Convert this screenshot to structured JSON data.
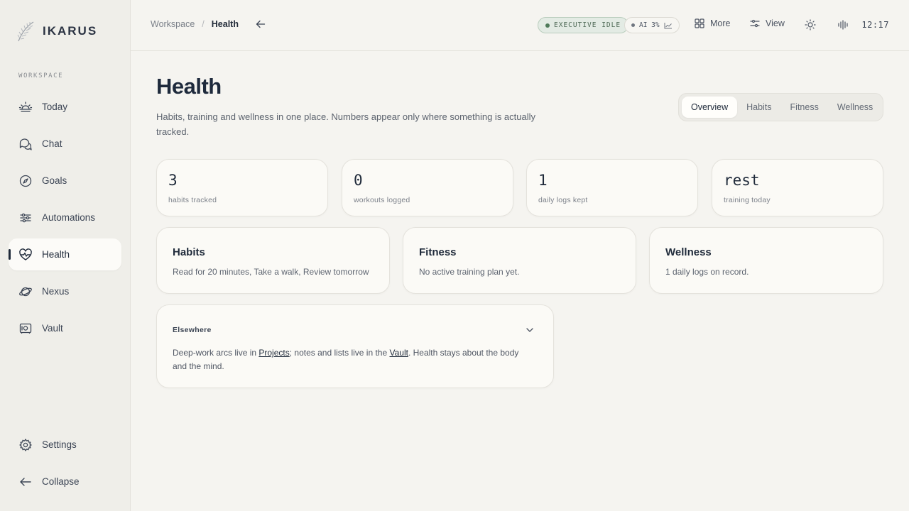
{
  "brand": {
    "name": "IKARUS"
  },
  "sidebar": {
    "section_label": "WORKSPACE",
    "items": [
      {
        "label": "Today",
        "icon": "sunrise-icon"
      },
      {
        "label": "Chat",
        "icon": "chat-bubbles-icon"
      },
      {
        "label": "Goals",
        "icon": "compass-icon"
      },
      {
        "label": "Automations",
        "icon": "sliders-icon"
      },
      {
        "label": "Health",
        "icon": "heart-pulse-icon",
        "active": true
      },
      {
        "label": "Nexus",
        "icon": "planet-icon"
      },
      {
        "label": "Vault",
        "icon": "safe-icon"
      }
    ],
    "settings_label": "Settings",
    "collapse_label": "Collapse"
  },
  "topbar": {
    "breadcrumb": {
      "root": "Workspace",
      "separator": "/",
      "current": "Health"
    },
    "status_badge": "EXECUTIVE IDLE",
    "ai_badge": "AI 3%",
    "more_label": "More",
    "view_label": "View",
    "clock": "12:17"
  },
  "main": {
    "title": "Health",
    "subtitle": "Habits, training and wellness in one place. Numbers appear only where something is actually tracked.",
    "tabs": [
      "Overview",
      "Habits",
      "Fitness",
      "Wellness"
    ],
    "active_tab": "Overview",
    "stats": [
      {
        "value": "3",
        "label": "habits tracked"
      },
      {
        "value": "0",
        "label": "workouts logged"
      },
      {
        "value": "1",
        "label": "daily logs kept"
      },
      {
        "value": "rest",
        "label": "training today"
      }
    ],
    "features": [
      {
        "title": "Habits",
        "text": "Read for 20 minutes, Take a walk, Review tomorrow"
      },
      {
        "title": "Fitness",
        "text": "No active training plan yet."
      },
      {
        "title": "Wellness",
        "text": "1 daily logs on record."
      }
    ],
    "elsewhere": {
      "title": "Elsewhere",
      "text_1": "Deep-work arcs live in ",
      "link_projects": "Projects",
      "text_2": "; notes and lists live in the ",
      "link_vault": "Vault",
      "text_3": ". Health stays about the body and the mind."
    }
  },
  "colors": {
    "background": "#f5f4f0",
    "sidebar": "#efeee9",
    "card": "#fbfaf6",
    "text_primary": "#1f2a3a",
    "status_green": "#4f7a5a"
  }
}
